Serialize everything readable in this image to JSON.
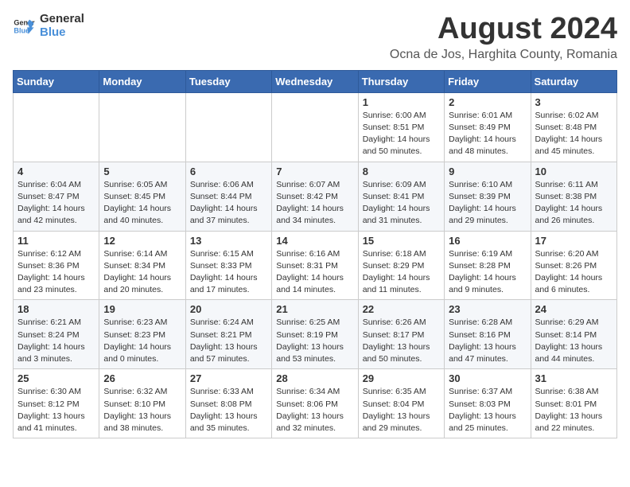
{
  "logo": {
    "line1": "General",
    "line2": "Blue"
  },
  "title": "August 2024",
  "subtitle": "Ocna de Jos, Harghita County, Romania",
  "header_days": [
    "Sunday",
    "Monday",
    "Tuesday",
    "Wednesday",
    "Thursday",
    "Friday",
    "Saturday"
  ],
  "weeks": [
    [
      {
        "day": "",
        "text": ""
      },
      {
        "day": "",
        "text": ""
      },
      {
        "day": "",
        "text": ""
      },
      {
        "day": "",
        "text": ""
      },
      {
        "day": "1",
        "text": "Sunrise: 6:00 AM\nSunset: 8:51 PM\nDaylight: 14 hours and 50 minutes."
      },
      {
        "day": "2",
        "text": "Sunrise: 6:01 AM\nSunset: 8:49 PM\nDaylight: 14 hours and 48 minutes."
      },
      {
        "day": "3",
        "text": "Sunrise: 6:02 AM\nSunset: 8:48 PM\nDaylight: 14 hours and 45 minutes."
      }
    ],
    [
      {
        "day": "4",
        "text": "Sunrise: 6:04 AM\nSunset: 8:47 PM\nDaylight: 14 hours and 42 minutes."
      },
      {
        "day": "5",
        "text": "Sunrise: 6:05 AM\nSunset: 8:45 PM\nDaylight: 14 hours and 40 minutes."
      },
      {
        "day": "6",
        "text": "Sunrise: 6:06 AM\nSunset: 8:44 PM\nDaylight: 14 hours and 37 minutes."
      },
      {
        "day": "7",
        "text": "Sunrise: 6:07 AM\nSunset: 8:42 PM\nDaylight: 14 hours and 34 minutes."
      },
      {
        "day": "8",
        "text": "Sunrise: 6:09 AM\nSunset: 8:41 PM\nDaylight: 14 hours and 31 minutes."
      },
      {
        "day": "9",
        "text": "Sunrise: 6:10 AM\nSunset: 8:39 PM\nDaylight: 14 hours and 29 minutes."
      },
      {
        "day": "10",
        "text": "Sunrise: 6:11 AM\nSunset: 8:38 PM\nDaylight: 14 hours and 26 minutes."
      }
    ],
    [
      {
        "day": "11",
        "text": "Sunrise: 6:12 AM\nSunset: 8:36 PM\nDaylight: 14 hours and 23 minutes."
      },
      {
        "day": "12",
        "text": "Sunrise: 6:14 AM\nSunset: 8:34 PM\nDaylight: 14 hours and 20 minutes."
      },
      {
        "day": "13",
        "text": "Sunrise: 6:15 AM\nSunset: 8:33 PM\nDaylight: 14 hours and 17 minutes."
      },
      {
        "day": "14",
        "text": "Sunrise: 6:16 AM\nSunset: 8:31 PM\nDaylight: 14 hours and 14 minutes."
      },
      {
        "day": "15",
        "text": "Sunrise: 6:18 AM\nSunset: 8:29 PM\nDaylight: 14 hours and 11 minutes."
      },
      {
        "day": "16",
        "text": "Sunrise: 6:19 AM\nSunset: 8:28 PM\nDaylight: 14 hours and 9 minutes."
      },
      {
        "day": "17",
        "text": "Sunrise: 6:20 AM\nSunset: 8:26 PM\nDaylight: 14 hours and 6 minutes."
      }
    ],
    [
      {
        "day": "18",
        "text": "Sunrise: 6:21 AM\nSunset: 8:24 PM\nDaylight: 14 hours and 3 minutes."
      },
      {
        "day": "19",
        "text": "Sunrise: 6:23 AM\nSunset: 8:23 PM\nDaylight: 14 hours and 0 minutes."
      },
      {
        "day": "20",
        "text": "Sunrise: 6:24 AM\nSunset: 8:21 PM\nDaylight: 13 hours and 57 minutes."
      },
      {
        "day": "21",
        "text": "Sunrise: 6:25 AM\nSunset: 8:19 PM\nDaylight: 13 hours and 53 minutes."
      },
      {
        "day": "22",
        "text": "Sunrise: 6:26 AM\nSunset: 8:17 PM\nDaylight: 13 hours and 50 minutes."
      },
      {
        "day": "23",
        "text": "Sunrise: 6:28 AM\nSunset: 8:16 PM\nDaylight: 13 hours and 47 minutes."
      },
      {
        "day": "24",
        "text": "Sunrise: 6:29 AM\nSunset: 8:14 PM\nDaylight: 13 hours and 44 minutes."
      }
    ],
    [
      {
        "day": "25",
        "text": "Sunrise: 6:30 AM\nSunset: 8:12 PM\nDaylight: 13 hours and 41 minutes."
      },
      {
        "day": "26",
        "text": "Sunrise: 6:32 AM\nSunset: 8:10 PM\nDaylight: 13 hours and 38 minutes."
      },
      {
        "day": "27",
        "text": "Sunrise: 6:33 AM\nSunset: 8:08 PM\nDaylight: 13 hours and 35 minutes."
      },
      {
        "day": "28",
        "text": "Sunrise: 6:34 AM\nSunset: 8:06 PM\nDaylight: 13 hours and 32 minutes."
      },
      {
        "day": "29",
        "text": "Sunrise: 6:35 AM\nSunset: 8:04 PM\nDaylight: 13 hours and 29 minutes."
      },
      {
        "day": "30",
        "text": "Sunrise: 6:37 AM\nSunset: 8:03 PM\nDaylight: 13 hours and 25 minutes."
      },
      {
        "day": "31",
        "text": "Sunrise: 6:38 AM\nSunset: 8:01 PM\nDaylight: 13 hours and 22 minutes."
      }
    ]
  ]
}
